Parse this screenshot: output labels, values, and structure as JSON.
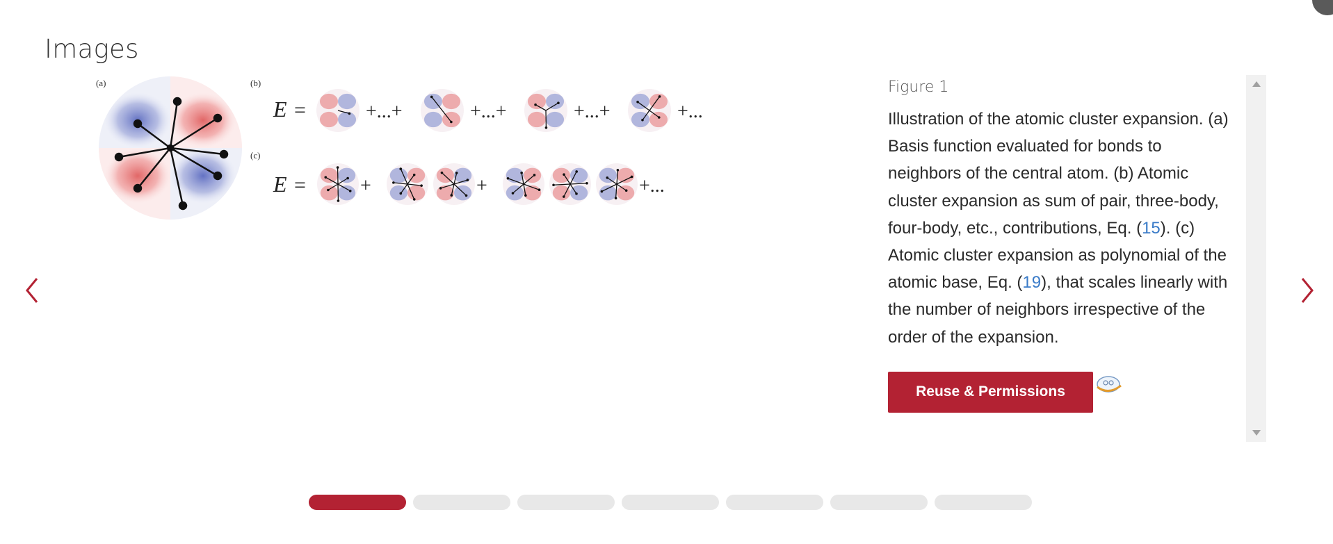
{
  "section": {
    "title": "Images"
  },
  "figure": {
    "label": "Figure 1",
    "panel_labels": [
      "(a)",
      "(b)",
      "(c)"
    ],
    "eq_symbol": "E",
    "equals": "=",
    "row_b_ops": [
      "+...+",
      "+...+",
      "+...+",
      "+..."
    ],
    "row_c_ops": [
      "+",
      "+",
      "+..."
    ],
    "caption": {
      "part1": "Illustration of the atomic cluster expansion. (a) Basis function evaluated for bonds to neighbors of the central atom. (b) Atomic cluster expansion as sum of pair, three-body, four-body, etc., contributions, Eq. (",
      "link1": "15",
      "part2": "). (c) Atomic cluster expansion as polynomial of the atomic base, Eq. (",
      "link2": "19",
      "part3": "), that scales linearly with the number of neighbors irrespective of the order of the expansion."
    },
    "reuse_label": "Reuse & Permissions"
  },
  "carousel": {
    "slide_count": 7,
    "active_index": 0
  },
  "colors": {
    "accent": "#b32233",
    "link": "#3a7bc8",
    "orbital_red": "#e57373",
    "orbital_blue": "#7986cb"
  },
  "icons": {
    "prev": "chevron-left-icon",
    "next": "chevron-right-icon",
    "license": "creative-commons-icon"
  }
}
